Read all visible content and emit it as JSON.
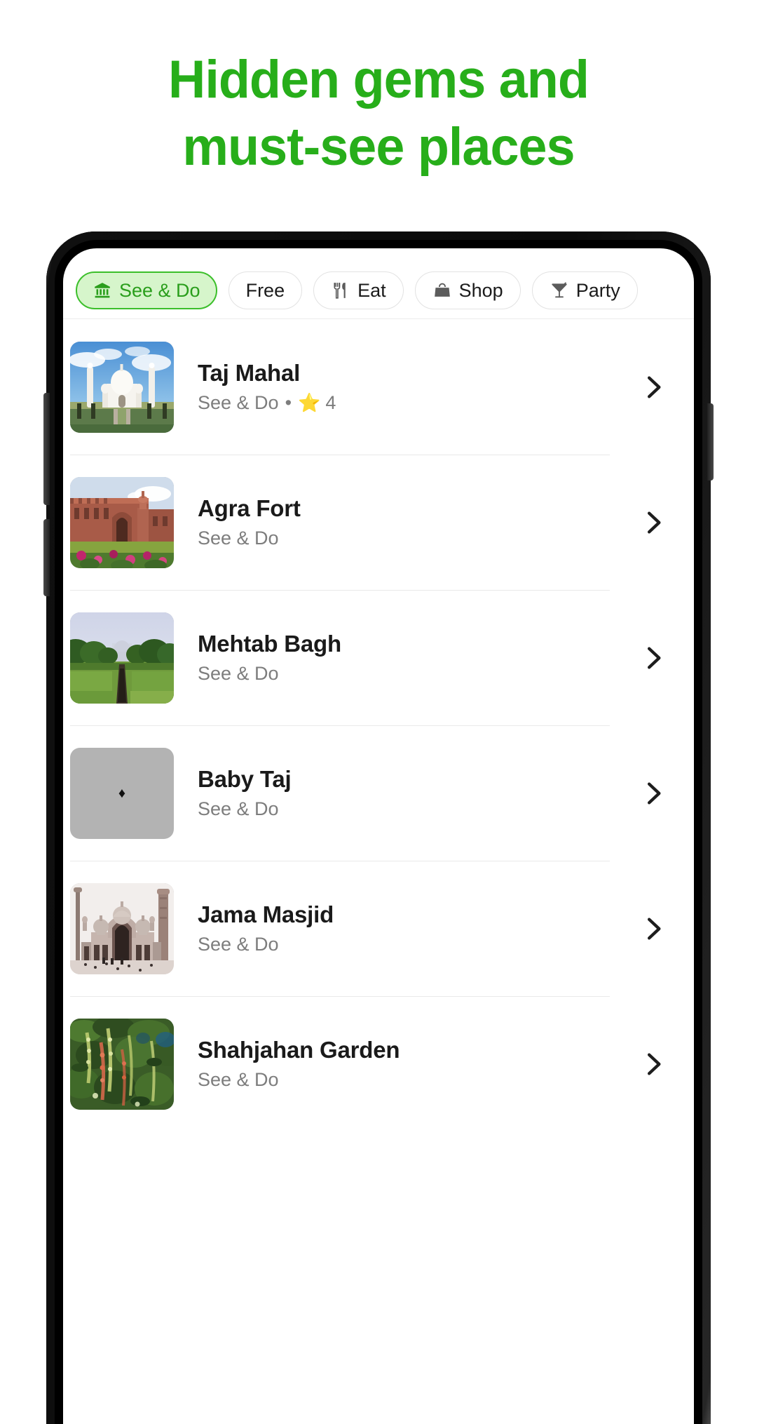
{
  "headline": {
    "line1": "Hidden gems and",
    "line2": "must-see places",
    "color": "#27ae1a"
  },
  "phone": {
    "volume_up_button": "Volume up",
    "volume_down_button": "Volume down",
    "power_button": "Power"
  },
  "filters": {
    "chips": [
      {
        "label": "See & Do",
        "icon": "museum-icon",
        "active": true
      },
      {
        "label": "Free",
        "icon": "none",
        "active": false
      },
      {
        "label": "Eat",
        "icon": "cutlery-icon",
        "active": false
      },
      {
        "label": "Shop",
        "icon": "shopping-bag-icon",
        "active": false
      },
      {
        "label": "Party",
        "icon": "cocktail-icon",
        "active": false
      }
    ],
    "active_color": "#2a9e1c",
    "active_fill": "#d6f5cb"
  },
  "list": {
    "items": [
      {
        "title": "Taj Mahal",
        "category": "See & Do",
        "separator": "•",
        "rating": "4",
        "has_rating": true,
        "thumb": "taj-mahal",
        "chevron": "chevron-right-icon"
      },
      {
        "title": "Agra Fort",
        "category": "See & Do",
        "has_rating": false,
        "thumb": "agra-fort",
        "chevron": "chevron-right-icon"
      },
      {
        "title": "Mehtab Bagh",
        "category": "See & Do",
        "has_rating": false,
        "thumb": "mehtab-bagh",
        "chevron": "chevron-right-icon"
      },
      {
        "title": "Baby Taj",
        "category": "See & Do",
        "has_rating": false,
        "thumb": "placeholder",
        "placeholder_glyph": "♦",
        "chevron": "chevron-right-icon"
      },
      {
        "title": "Jama Masjid",
        "category": "See & Do",
        "has_rating": false,
        "thumb": "jama-masjid",
        "chevron": "chevron-right-icon"
      },
      {
        "title": "Shahjahan Garden",
        "category": "See & Do",
        "has_rating": false,
        "thumb": "shahjahan-garden",
        "chevron": "chevron-right-icon"
      }
    ]
  }
}
